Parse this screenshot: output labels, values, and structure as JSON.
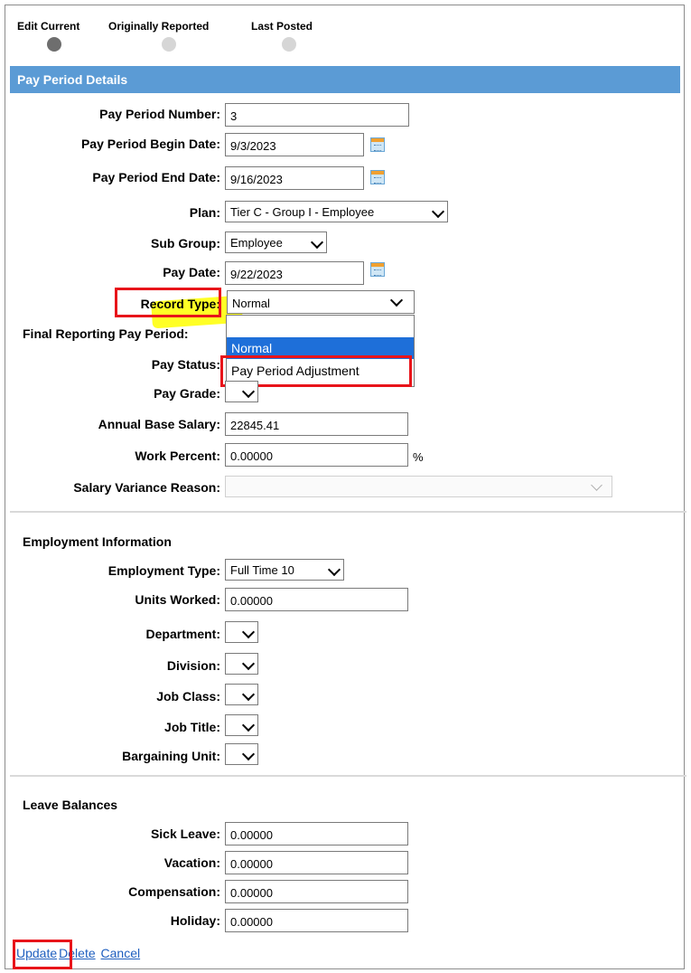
{
  "tabs": [
    {
      "label": "Edit Current",
      "active": true
    },
    {
      "label": "Originally Reported",
      "active": false
    },
    {
      "label": "Last Posted",
      "active": false
    }
  ],
  "section_header": "Pay Period Details",
  "fields": {
    "pay_period_number": {
      "label": "Pay Period Number:",
      "value": "3"
    },
    "pay_period_begin": {
      "label": "Pay Period Begin Date:",
      "value": "9/3/2023"
    },
    "pay_period_end": {
      "label": "Pay Period End Date:",
      "value": "9/16/2023"
    },
    "plan": {
      "label": "Plan:",
      "value": "Tier C - Group I - Employee"
    },
    "sub_group": {
      "label": "Sub Group:",
      "value": "Employee"
    },
    "pay_date": {
      "label": "Pay Date:",
      "value": "9/22/2023"
    },
    "record_type": {
      "label": "Record Type:",
      "value": "Normal",
      "options": [
        "",
        "Normal",
        "Pay Period Adjustment"
      ]
    },
    "final_reporting": {
      "label": "Final Reporting Pay Period:"
    },
    "pay_status": {
      "label": "Pay Status:"
    },
    "pay_grade": {
      "label": "Pay Grade:"
    },
    "annual_base_salary": {
      "label": "Annual Base Salary:",
      "value": "22845.41"
    },
    "work_percent": {
      "label": "Work Percent:",
      "value": "0.00000",
      "unit": "%"
    },
    "salary_variance_reason": {
      "label": "Salary Variance Reason:",
      "value": ""
    }
  },
  "employment": {
    "title": "Employment Information",
    "employment_type": {
      "label": "Employment Type:",
      "value": "Full Time 10"
    },
    "units_worked": {
      "label": "Units Worked:",
      "value": "0.00000"
    },
    "department": {
      "label": "Department:"
    },
    "division": {
      "label": "Division:"
    },
    "job_class": {
      "label": "Job Class:"
    },
    "job_title": {
      "label": "Job Title:"
    },
    "bargaining_unit": {
      "label": "Bargaining Unit:"
    }
  },
  "leave": {
    "title": "Leave Balances",
    "sick_leave": {
      "label": "Sick Leave:",
      "value": "0.00000"
    },
    "vacation": {
      "label": "Vacation:",
      "value": "0.00000"
    },
    "compensation": {
      "label": "Compensation:",
      "value": "0.00000"
    },
    "holiday": {
      "label": "Holiday:",
      "value": "0.00000"
    }
  },
  "actions": {
    "update": "Update",
    "delete": "Delete",
    "cancel": "Cancel"
  },
  "colors": {
    "header_bg": "#5b9bd5",
    "selected_option": "#1e6fd9",
    "annotation_red": "#e8141a",
    "highlight": "#ffff00"
  }
}
